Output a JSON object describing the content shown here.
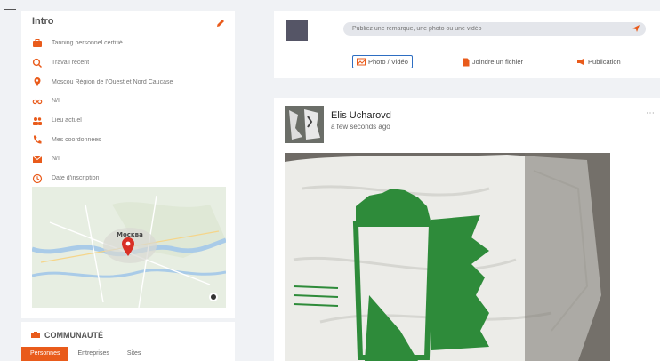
{
  "intro": {
    "title": "Intro",
    "items": [
      {
        "icon": "briefcase-icon",
        "text": "Tanning personnel certifié"
      },
      {
        "icon": "search-icon",
        "text": "Travail récent"
      },
      {
        "icon": "location-pin-icon",
        "text": "Moscou Région de l'Ouest et Nord Caucase"
      },
      {
        "icon": "glasses-icon",
        "text": "N/I"
      },
      {
        "icon": "people-icon",
        "text": "Lieu actuel"
      },
      {
        "icon": "phone-icon",
        "text": "Mes coordonnées"
      },
      {
        "icon": "mail-icon",
        "text": "N/I"
      },
      {
        "icon": "clock-icon",
        "text": "Date d'inscription"
      }
    ],
    "map": {
      "city_label": "Москва"
    }
  },
  "community": {
    "title": "COMMUNAUTÉ",
    "tabs": [
      "Personnes",
      "Entreprises",
      "Sites"
    ]
  },
  "create_post": {
    "placeholder": "Publiez une remarque, une photo ou une vidéo",
    "actions": [
      {
        "icon": "photo-video-icon",
        "label": "Photo / Vidéo"
      },
      {
        "icon": "file-icon",
        "label": "Joindre un fichier"
      },
      {
        "icon": "megaphone-icon",
        "label": "Publication"
      }
    ]
  },
  "post": {
    "author": "Elis Ucharovd",
    "time": "a few seconds ago",
    "more": "⋯"
  },
  "colors": {
    "accent": "#e95b1b",
    "outline": "#2e6ec2",
    "map_water": "#a9cbe8",
    "map_pin": "#d93025",
    "flag_green": "#2e8b3a"
  }
}
